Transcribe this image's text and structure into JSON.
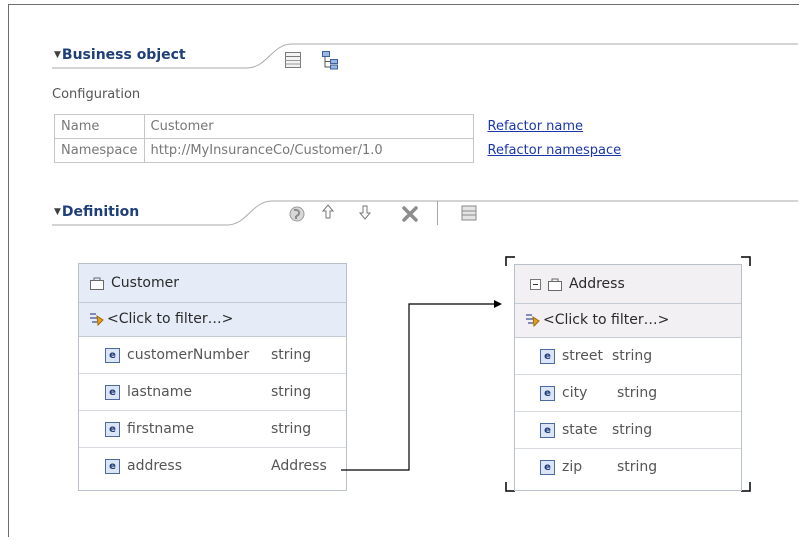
{
  "business_object_section": {
    "title": "Business object",
    "configuration_label": "Configuration",
    "rows": [
      {
        "label": "Name",
        "value": "Customer",
        "link": "Refactor name"
      },
      {
        "label": "Namespace",
        "value": "http://MyInsuranceCo/Customer/1.0",
        "link": "Refactor namespace"
      }
    ],
    "toolbar_icons": [
      "table-view-icon",
      "tree-view-icon"
    ]
  },
  "definition_section": {
    "title": "Definition",
    "toolbar_icons": [
      "add-field-icon",
      "move-up-icon",
      "move-down-icon",
      "delete-icon",
      "layout-icon"
    ]
  },
  "customer_bo": {
    "name": "Customer",
    "filter_text": "<Click to filter…>",
    "fields": [
      {
        "name": "customerNumber",
        "type": "string"
      },
      {
        "name": "lastname",
        "type": "string"
      },
      {
        "name": "firstname",
        "type": "string"
      },
      {
        "name": "address",
        "type": "Address"
      }
    ]
  },
  "address_bo": {
    "name": "Address",
    "filter_text": "<Click to filter…>",
    "fields": [
      {
        "name": "street",
        "type": "string"
      },
      {
        "name": "city",
        "type": "string"
      },
      {
        "name": "state",
        "type": "string"
      },
      {
        "name": "zip",
        "type": "string"
      }
    ]
  },
  "field_icon_glyph": "e",
  "colors": {
    "title": "#1f3f7a",
    "link": "#1c37a8",
    "header_bg": "#e5ebf7",
    "selected_header_bg": "#f3f0f3"
  }
}
